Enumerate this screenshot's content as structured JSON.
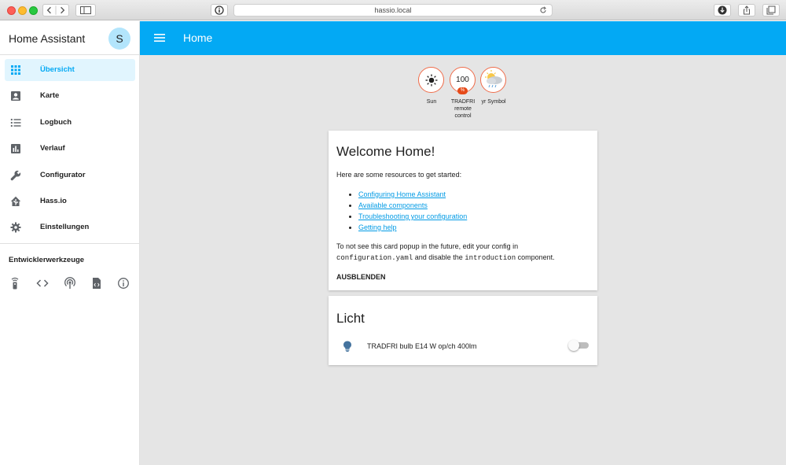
{
  "browser": {
    "url": "hassio.local"
  },
  "sidebar": {
    "title": "Home Assistant",
    "avatar_initial": "S",
    "items": [
      {
        "label": "Übersicht",
        "icon": "view-dashboard-icon",
        "active": true
      },
      {
        "label": "Karte",
        "icon": "account-box-icon",
        "active": false
      },
      {
        "label": "Logbuch",
        "icon": "format-list-bulleted-icon",
        "active": false
      },
      {
        "label": "Verlauf",
        "icon": "poll-box-icon",
        "active": false
      },
      {
        "label": "Configurator",
        "icon": "wrench-icon",
        "active": false
      },
      {
        "label": "Hass.io",
        "icon": "home-assistant-icon",
        "active": false
      },
      {
        "label": "Einstellungen",
        "icon": "settings-icon",
        "active": false
      }
    ],
    "dev_tools_title": "Entwicklerwerkzeuge",
    "dev_tools": [
      "remote-icon",
      "code-tags-icon",
      "access-point-icon",
      "file-xml-icon",
      "information-outline-icon"
    ]
  },
  "header": {
    "title": "Home"
  },
  "badges": [
    {
      "label": "Sun",
      "icon": "sun-icon"
    },
    {
      "label": "TRADFRI remote control",
      "value": "100",
      "unit": "%"
    },
    {
      "label": "yr Symbol",
      "icon": "weather-rain-icon"
    }
  ],
  "welcome_card": {
    "title": "Welcome Home!",
    "intro": "Here are some resources to get started:",
    "links": [
      "Configuring Home Assistant",
      "Available components",
      "Troubleshooting your configuration",
      "Getting help"
    ],
    "note_pre": "To not see this card popup in the future, edit your config in",
    "note_code1": "configuration.yaml",
    "note_mid": " and disable the ",
    "note_code2": "introduction",
    "note_post": " component.",
    "dismiss": "AUSBLENDEN"
  },
  "light_card": {
    "title": "Licht",
    "entity": "TRADFRI bulb E14 W op/ch 400lm",
    "state": "off"
  },
  "colors": {
    "primary": "#03a9f4",
    "badge_border": "#ef6c4a",
    "link": "#039be5",
    "background": "#e5e5e5"
  }
}
